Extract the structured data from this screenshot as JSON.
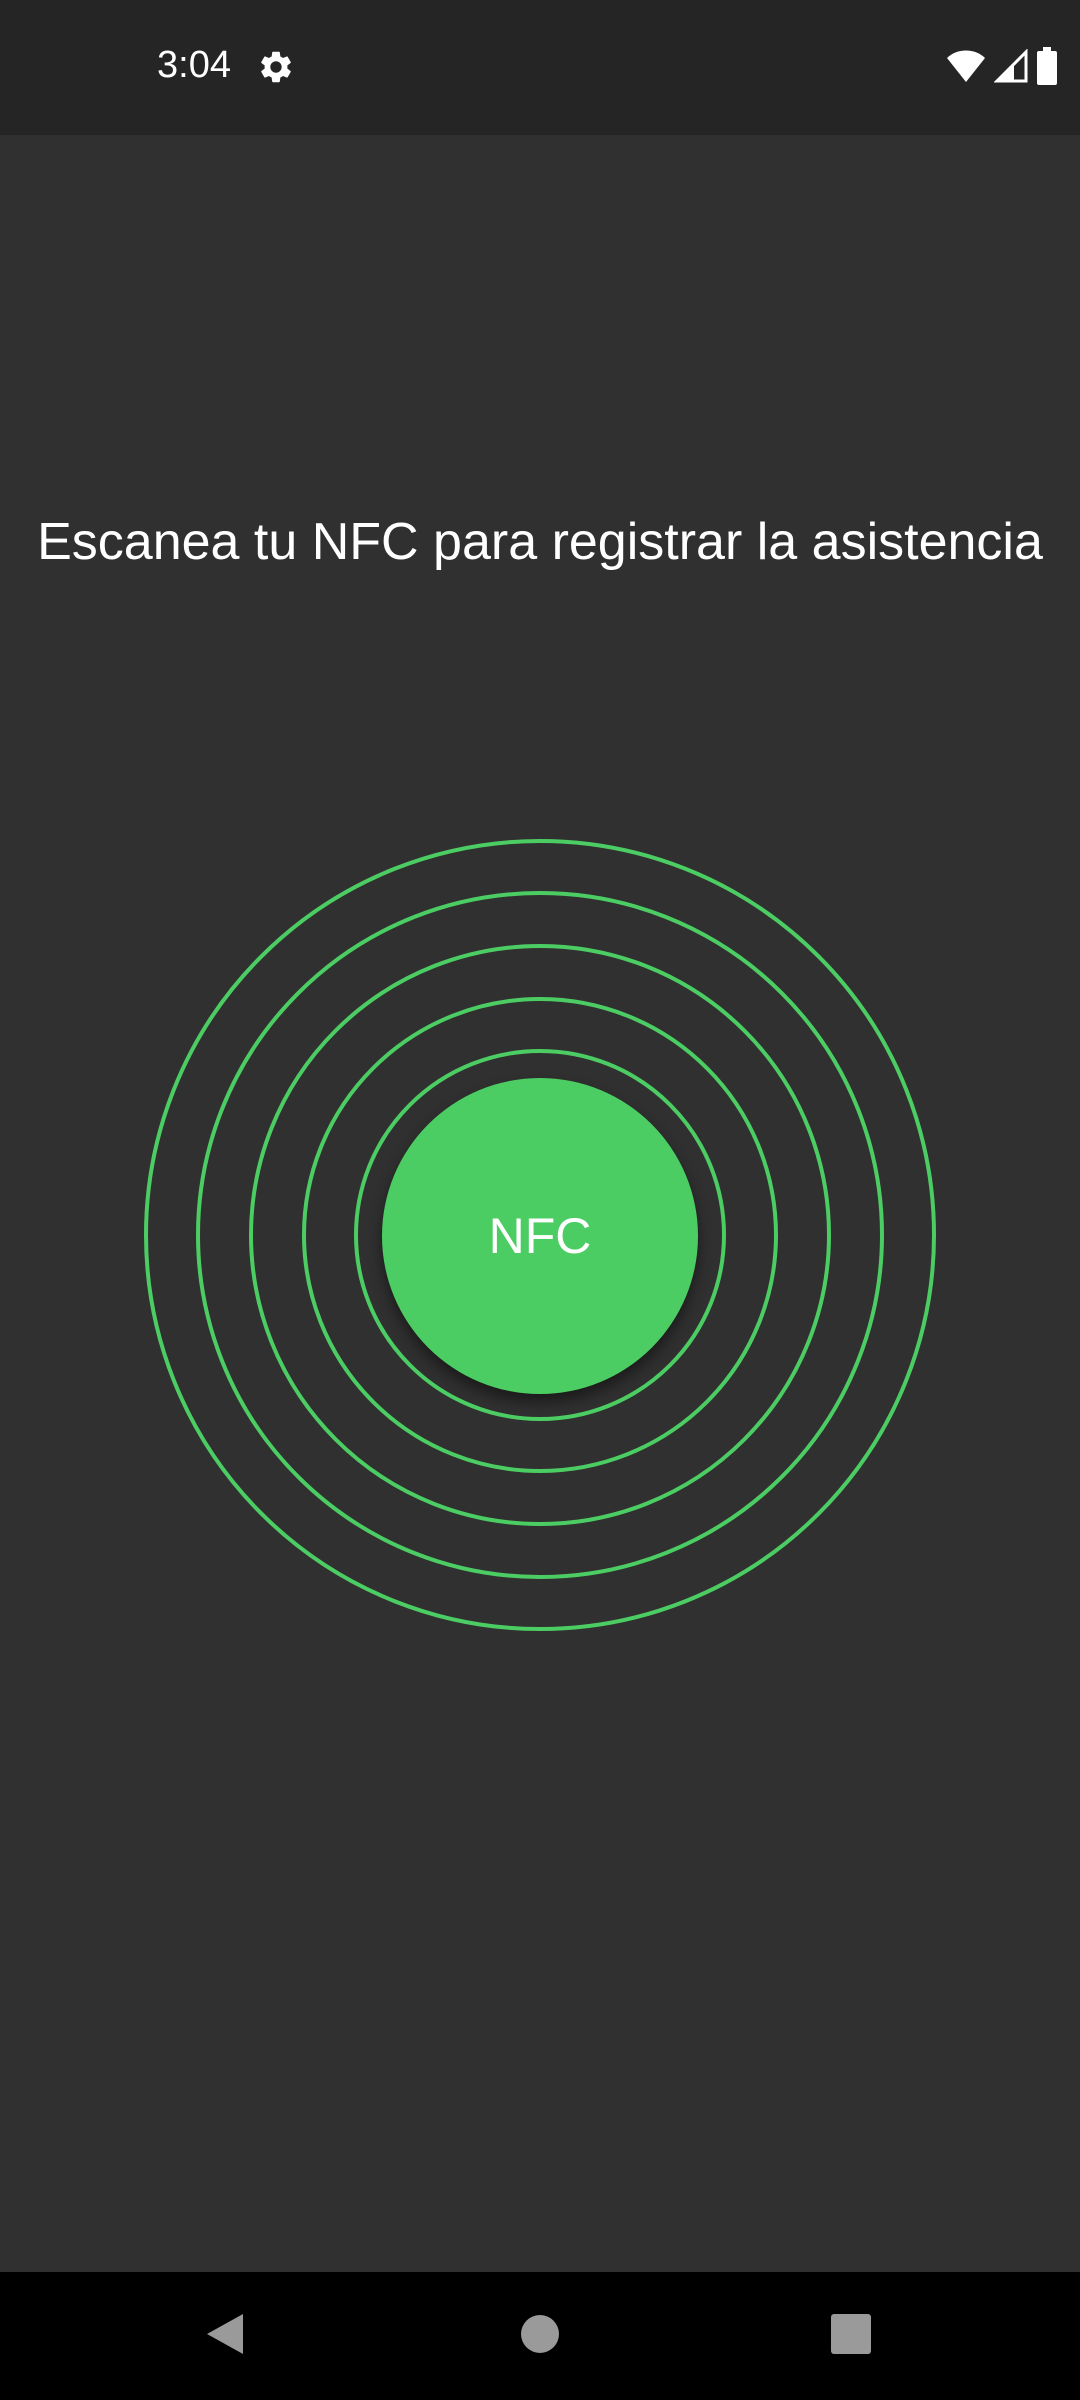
{
  "status_bar": {
    "time": "3:04",
    "icons": [
      "settings-icon",
      "wifi-icon",
      "cellular-signal-icon",
      "battery-icon"
    ]
  },
  "main": {
    "prompt": "Escanea tu NFC para registrar la asistencia",
    "nfc_button_label": "NFC"
  },
  "nav_bar": {
    "buttons": [
      "back-icon",
      "home-icon",
      "recents-icon"
    ]
  },
  "colors": {
    "accent": "#4ccd63",
    "background": "#303030",
    "status_bar": "#252525",
    "nav_bar": "#000000"
  }
}
